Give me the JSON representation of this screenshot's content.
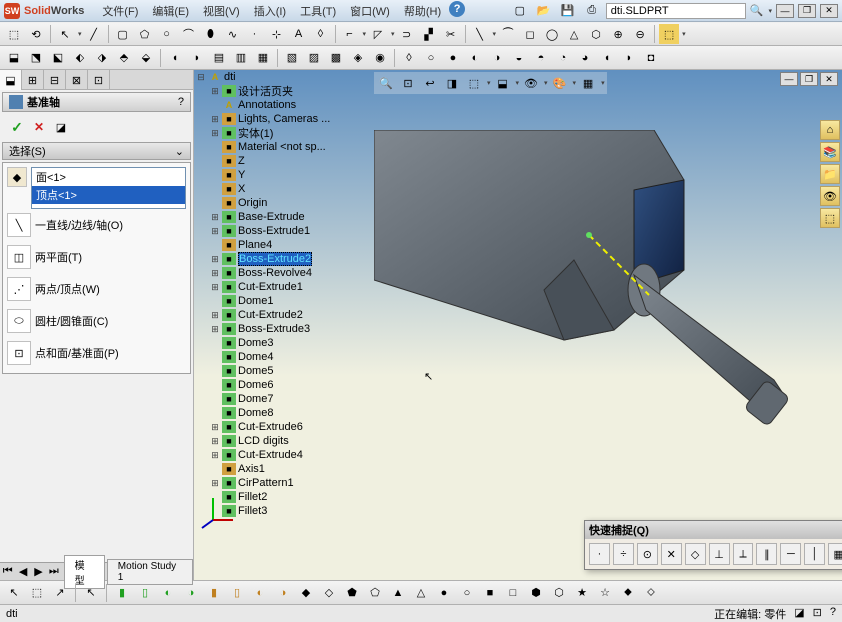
{
  "app": {
    "name_prefix": "Solid",
    "name_suffix": "Works",
    "doc": "dti.SLDPRT"
  },
  "menu": [
    "文件(F)",
    "编辑(E)",
    "视图(V)",
    "插入(I)",
    "工具(T)",
    "窗口(W)",
    "帮助(H)"
  ],
  "panel": {
    "header": "基准轴",
    "section": "选择(S)",
    "items": [
      "面<1>",
      "顶点<1>"
    ],
    "options": [
      {
        "label": "一直线/边线/轴(O)"
      },
      {
        "label": "两平面(T)"
      },
      {
        "label": "两点/顶点(W)"
      },
      {
        "label": "圆柱/圆锥面(C)"
      },
      {
        "label": "点和面/基准面(P)"
      }
    ]
  },
  "tree": [
    {
      "ind": 0,
      "exp": "-",
      "icon": "ic-y",
      "label": "dti"
    },
    {
      "ind": 1,
      "exp": "+",
      "icon": "ic-feat",
      "label": "设计活页夹"
    },
    {
      "ind": 1,
      "exp": "",
      "icon": "ic-y",
      "label": "Annotations"
    },
    {
      "ind": 1,
      "exp": "+",
      "icon": "ic-ref",
      "label": "Lights, Cameras ..."
    },
    {
      "ind": 1,
      "exp": "+",
      "icon": "ic-feat",
      "label": "实体(1)"
    },
    {
      "ind": 1,
      "exp": "",
      "icon": "ic-ref",
      "label": "Material <not sp..."
    },
    {
      "ind": 1,
      "exp": "",
      "icon": "ic-ref",
      "label": "Z"
    },
    {
      "ind": 1,
      "exp": "",
      "icon": "ic-ref",
      "label": "Y"
    },
    {
      "ind": 1,
      "exp": "",
      "icon": "ic-ref",
      "label": "X"
    },
    {
      "ind": 1,
      "exp": "",
      "icon": "ic-ref",
      "label": "Origin"
    },
    {
      "ind": 1,
      "exp": "+",
      "icon": "ic-feat",
      "label": "Base-Extrude"
    },
    {
      "ind": 1,
      "exp": "+",
      "icon": "ic-feat",
      "label": "Boss-Extrude1"
    },
    {
      "ind": 1,
      "exp": "",
      "icon": "ic-ref",
      "label": "Plane4"
    },
    {
      "ind": 1,
      "exp": "+",
      "icon": "ic-feat",
      "label": "Boss-Extrude2",
      "sel": true
    },
    {
      "ind": 1,
      "exp": "+",
      "icon": "ic-feat",
      "label": "Boss-Revolve4"
    },
    {
      "ind": 1,
      "exp": "+",
      "icon": "ic-feat",
      "label": "Cut-Extrude1"
    },
    {
      "ind": 1,
      "exp": "",
      "icon": "ic-feat",
      "label": "Dome1"
    },
    {
      "ind": 1,
      "exp": "+",
      "icon": "ic-feat",
      "label": "Cut-Extrude2"
    },
    {
      "ind": 1,
      "exp": "+",
      "icon": "ic-feat",
      "label": "Boss-Extrude3"
    },
    {
      "ind": 1,
      "exp": "",
      "icon": "ic-feat",
      "label": "Dome3"
    },
    {
      "ind": 1,
      "exp": "",
      "icon": "ic-feat",
      "label": "Dome4"
    },
    {
      "ind": 1,
      "exp": "",
      "icon": "ic-feat",
      "label": "Dome5"
    },
    {
      "ind": 1,
      "exp": "",
      "icon": "ic-feat",
      "label": "Dome6"
    },
    {
      "ind": 1,
      "exp": "",
      "icon": "ic-feat",
      "label": "Dome7"
    },
    {
      "ind": 1,
      "exp": "",
      "icon": "ic-feat",
      "label": "Dome8"
    },
    {
      "ind": 1,
      "exp": "+",
      "icon": "ic-feat",
      "label": "Cut-Extrude6"
    },
    {
      "ind": 1,
      "exp": "+",
      "icon": "ic-feat",
      "label": "LCD digits"
    },
    {
      "ind": 1,
      "exp": "+",
      "icon": "ic-feat",
      "label": "Cut-Extrude4"
    },
    {
      "ind": 1,
      "exp": "",
      "icon": "ic-ref",
      "label": "Axis1"
    },
    {
      "ind": 1,
      "exp": "+",
      "icon": "ic-feat",
      "label": "CirPattern1"
    },
    {
      "ind": 1,
      "exp": "",
      "icon": "ic-feat",
      "label": "Fillet2"
    },
    {
      "ind": 1,
      "exp": "",
      "icon": "ic-feat",
      "label": "Fillet3"
    }
  ],
  "quick_snap": {
    "title": "快速捕捉(Q)"
  },
  "bottom_tabs": {
    "t1": "模型",
    "t2": "Motion Study 1"
  },
  "status": {
    "left": "dti",
    "right": "正在编辑: 零件"
  }
}
